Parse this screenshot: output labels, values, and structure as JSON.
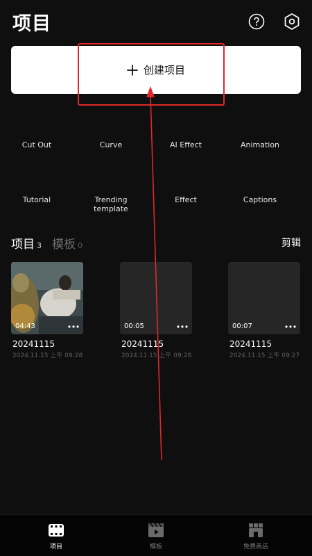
{
  "header": {
    "title": "项目"
  },
  "create": {
    "label": "创建项目"
  },
  "tools": [
    "Cut Out",
    "Curve",
    "AI Effect",
    "Animation",
    "Tutorial",
    "Trending template",
    "Effect",
    "Captions"
  ],
  "section": {
    "projects_label": "项目",
    "projects_count": "3",
    "templates_label": "模板",
    "templates_count": "0",
    "edit_label": "剪辑"
  },
  "projects": [
    {
      "name": "20241115",
      "date": "2024.11.15 上午 09:28",
      "duration": "04:43"
    },
    {
      "name": "20241115",
      "date": "2024.11.15 上午 09:28",
      "duration": "00:05"
    },
    {
      "name": "20241115",
      "date": "2024.11.15 上午 09:27",
      "duration": "00:07"
    }
  ],
  "nav": [
    {
      "label": "项目",
      "active": true
    },
    {
      "label": "模板",
      "active": false
    },
    {
      "label": "免费商店",
      "active": false
    }
  ],
  "colors": {
    "background": "#0f0f0f",
    "annotation": "#e02828",
    "card": "#ffffff"
  },
  "icons": [
    "help-icon",
    "settings-icon",
    "plus-icon",
    "more-icon",
    "projects-nav-icon",
    "templates-nav-icon",
    "store-nav-icon"
  ]
}
